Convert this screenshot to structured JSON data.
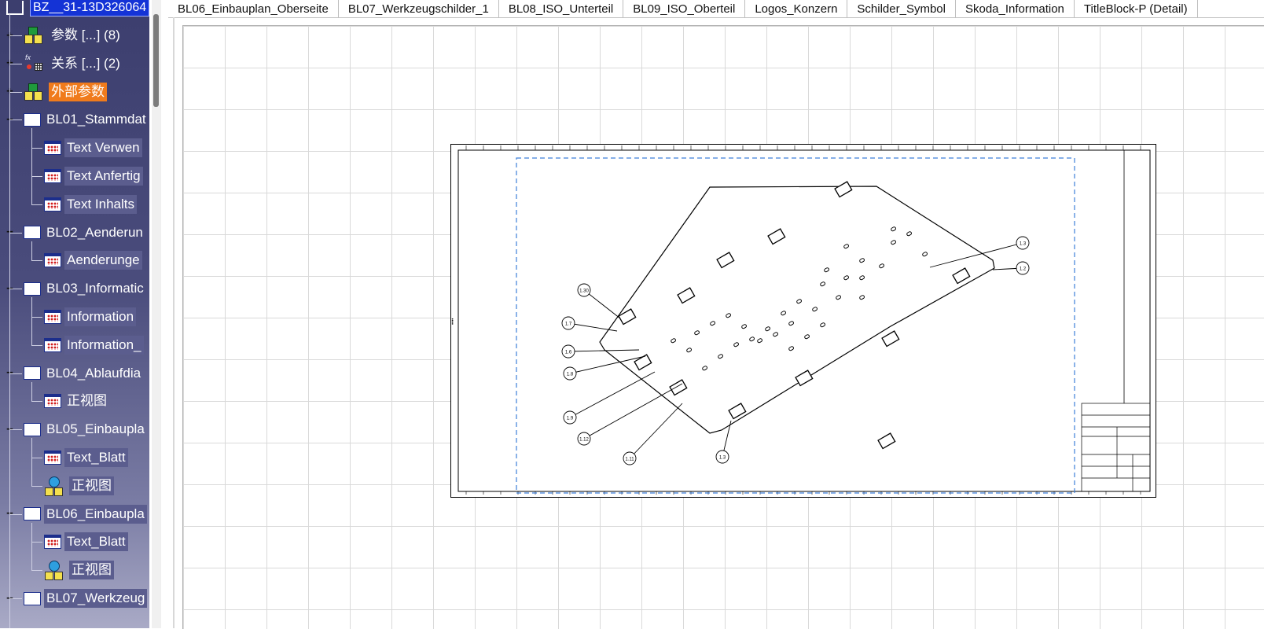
{
  "tree": {
    "root_label": "BZ__31-13D326064",
    "items": [
      {
        "label": "参数 [...] (8)",
        "icon": "parameters-icon",
        "expander": "+"
      },
      {
        "label": "关系 [...] (2)",
        "icon": "relations-icon",
        "expander": "+"
      },
      {
        "label": "外部参数",
        "icon": "external-parameters-icon",
        "expander": "+"
      },
      {
        "label": "BL01_Stammdat",
        "icon": "sheet-icon",
        "expander": "−"
      },
      {
        "label": "Text Verwen",
        "icon": "view-icon"
      },
      {
        "label": "Text Anfertig",
        "icon": "view-icon"
      },
      {
        "label": "Text Inhalts",
        "icon": "view-icon"
      },
      {
        "label": "BL02_Aenderun",
        "icon": "sheet-icon",
        "expander": "−"
      },
      {
        "label": "Aenderunge",
        "icon": "view-icon"
      },
      {
        "label": "BL03_Informatic",
        "icon": "sheet-icon",
        "expander": "−"
      },
      {
        "label": "Information",
        "icon": "view-icon"
      },
      {
        "label": "Information_",
        "icon": "view-icon"
      },
      {
        "label": "BL04_Ablaufdia",
        "icon": "sheet-icon",
        "expander": "−"
      },
      {
        "label": "正视图",
        "icon": "view-icon"
      },
      {
        "label": "BL05_Einbaupla",
        "icon": "sheet-icon",
        "expander": "−"
      },
      {
        "label": "Text_Blatt",
        "icon": "view-icon"
      },
      {
        "label": "正视图",
        "icon": "symbol-view-icon"
      },
      {
        "label": "BL06_Einbaupla",
        "icon": "sheet-icon",
        "expander": "−"
      },
      {
        "label": "Text_Blatt",
        "icon": "view-icon"
      },
      {
        "label": "正视图",
        "icon": "symbol-view-icon"
      },
      {
        "label": "BL07_Werkzeug",
        "icon": "sheet-icon",
        "expander": "−"
      }
    ]
  },
  "tabs": [
    "BL06_Einbauplan_Oberseite",
    "BL07_Werkzeugschilder_1",
    "BL08_ISO_Unterteil",
    "BL09_ISO_Oberteil",
    "Logos_Konzern",
    "Schilder_Symbol",
    "Skoda_Information",
    "TitleBlock-P (Detail)"
  ],
  "drawing": {
    "callouts": [
      "1.30",
      "1.7",
      "1.6",
      "1.8",
      "1.9",
      "1.12",
      "1.11",
      "1.3",
      "1.3",
      "1.2"
    ]
  },
  "colors": {
    "tree_bg_top": "#3c3e6e",
    "highlight": "#f07b1c",
    "selection": "#1433d6",
    "frame_dash": "#3d7fd9"
  }
}
